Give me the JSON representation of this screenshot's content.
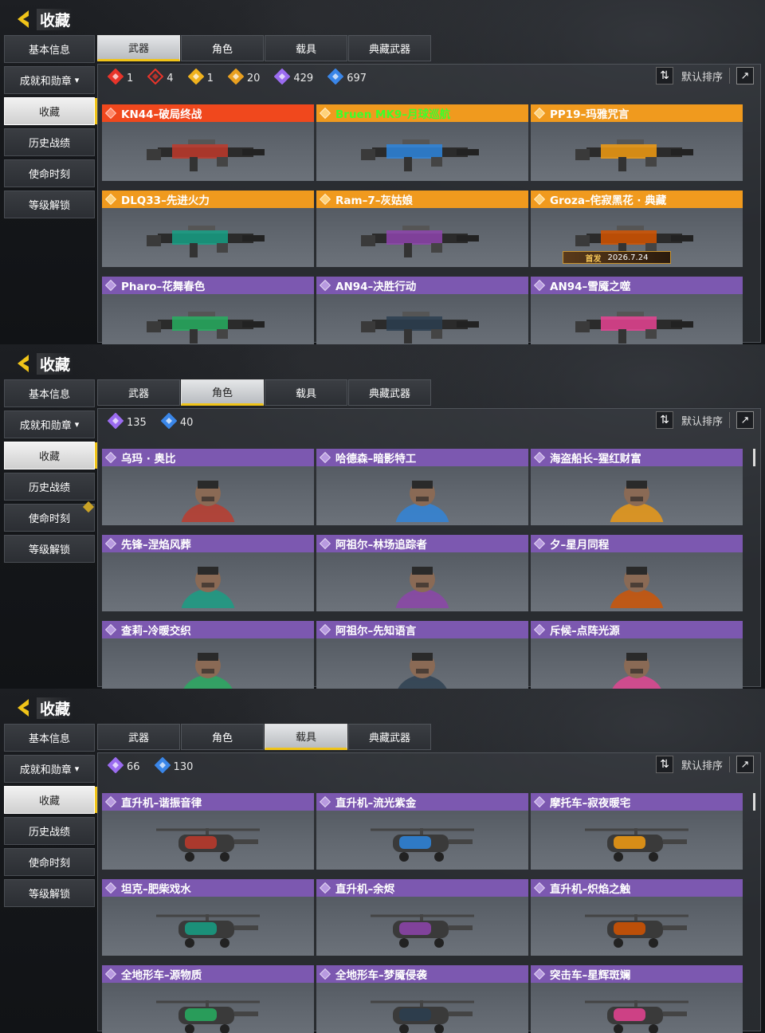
{
  "title": "收藏",
  "sidebar": {
    "items": [
      {
        "label": "基本信息"
      },
      {
        "label": "成就和勋章"
      },
      {
        "label": "收藏"
      },
      {
        "label": "历史战绩"
      },
      {
        "label": "使命时刻"
      },
      {
        "label": "等级解锁"
      }
    ]
  },
  "tabs": [
    "武器",
    "角色",
    "载具",
    "典藏武器"
  ],
  "sort": {
    "label": "默认排序"
  },
  "panels": [
    {
      "active_tab": "武器",
      "stats": [
        {
          "icon": "red-rarity-icon",
          "color": "#e8342a",
          "count": "1"
        },
        {
          "icon": "red-outline-rarity-icon",
          "color": "#e8342a",
          "count": "4"
        },
        {
          "icon": "gold-rarity-icon",
          "color": "#f0b21e",
          "count": "1"
        },
        {
          "icon": "orange-rarity-icon",
          "color": "#e9a020",
          "count": "20"
        },
        {
          "icon": "purple-rarity-icon",
          "color": "#9b6cf0",
          "count": "429"
        },
        {
          "icon": "blue-rarity-icon",
          "color": "#3a86e8",
          "count": "697"
        }
      ],
      "cards": [
        {
          "name": "KN44–破局终战",
          "tier": "red"
        },
        {
          "name": "Bruen MK9–月球巡航",
          "tier": "orange",
          "green": true
        },
        {
          "name": "PP19–玛雅咒言",
          "tier": "orange"
        },
        {
          "name": "DLQ33–先进火力",
          "tier": "orange"
        },
        {
          "name": "Ram–7–灰姑娘",
          "tier": "orange"
        },
        {
          "name": "Groza–侘寂黑花 · 典藏",
          "tier": "orange",
          "badge": {
            "tag": "首发",
            "date": "2026.7.24"
          }
        },
        {
          "name": "Pharo–花舞春色",
          "tier": "purple"
        },
        {
          "name": "AN94–决胜行动",
          "tier": "purple"
        },
        {
          "name": "AN94–雪魇之噬",
          "tier": "purple"
        }
      ]
    },
    {
      "active_tab": "角色",
      "stats": [
        {
          "icon": "purple-rarity-icon",
          "color": "#9b6cf0",
          "count": "135"
        },
        {
          "icon": "blue-rarity-icon",
          "color": "#3a86e8",
          "count": "40"
        }
      ],
      "cards": [
        {
          "name": "乌玛 · 奥比",
          "tier": "purple"
        },
        {
          "name": "哈德森–暗影特工",
          "tier": "purple"
        },
        {
          "name": "海盗船长–猩红财富",
          "tier": "purple"
        },
        {
          "name": "先锋–涅焰风葬",
          "tier": "purple"
        },
        {
          "name": "阿祖尔–林场追踪者",
          "tier": "purple"
        },
        {
          "name": "夕–星月同程",
          "tier": "purple"
        },
        {
          "name": "查莉–冷暖交织",
          "tier": "purple"
        },
        {
          "name": "阿祖尔–先知语言",
          "tier": "purple"
        },
        {
          "name": "斥候–点阵光源",
          "tier": "purple"
        }
      ]
    },
    {
      "active_tab": "载具",
      "stats": [
        {
          "icon": "purple-rarity-icon",
          "color": "#9b6cf0",
          "count": "66"
        },
        {
          "icon": "blue-rarity-icon",
          "color": "#3a86e8",
          "count": "130"
        }
      ],
      "cards": [
        {
          "name": "直升机–谐振音律",
          "tier": "purple"
        },
        {
          "name": "直升机–流光紫金",
          "tier": "purple"
        },
        {
          "name": "摩托车–寂夜暖宅",
          "tier": "purple"
        },
        {
          "name": "坦克–肥柴戏水",
          "tier": "purple"
        },
        {
          "name": "直升机–余烬",
          "tier": "purple"
        },
        {
          "name": "直升机–炽焰之触",
          "tier": "purple"
        },
        {
          "name": "全地形车–源物质",
          "tier": "purple"
        },
        {
          "name": "全地形车–梦魇侵袭",
          "tier": "purple"
        },
        {
          "name": "突击车–星辉斑斓",
          "tier": "purple"
        }
      ]
    }
  ]
}
